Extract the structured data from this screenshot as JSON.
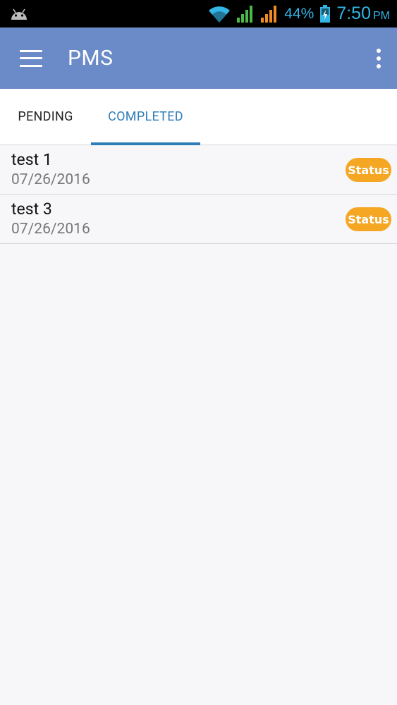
{
  "status_bar": {
    "battery": "44%",
    "time": "7:50",
    "ampm": "PM"
  },
  "app_bar": {
    "title": "PMS"
  },
  "tabs": [
    {
      "label": "PENDING",
      "selected": false
    },
    {
      "label": "COMPLETED",
      "selected": true
    }
  ],
  "list": [
    {
      "title": "test 1",
      "date": "07/26/2016",
      "badge": "Status"
    },
    {
      "title": "test 3",
      "date": "07/26/2016",
      "badge": "Status"
    }
  ],
  "colors": {
    "app_bar": "#6a8ac8",
    "tab_active": "#2e7db8",
    "badge": "#f5a623",
    "status_text": "#33b5e5"
  }
}
